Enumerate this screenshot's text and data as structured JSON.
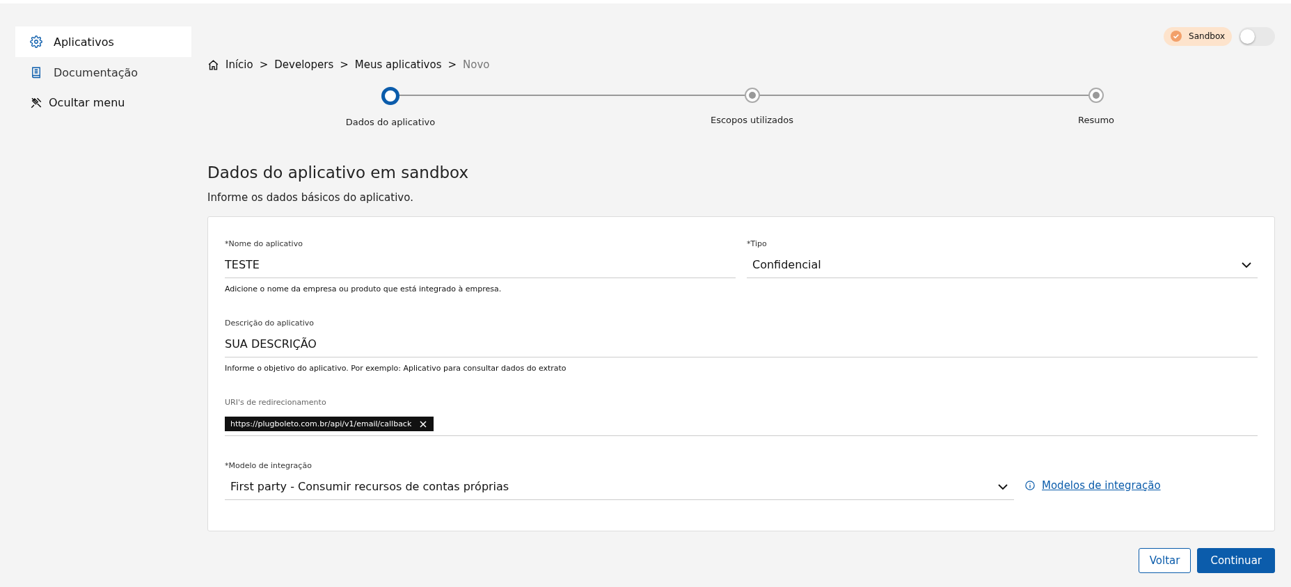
{
  "sidebar": {
    "items": [
      {
        "label": "Aplicativos",
        "kind": "gear",
        "selected": true
      },
      {
        "label": "Documentação",
        "kind": "book",
        "selected": false
      }
    ],
    "hide_menu": "Ocultar menu"
  },
  "sandbox": {
    "label": "Sandbox",
    "on": false
  },
  "breadcrumb": [
    {
      "label": "Início",
      "current": false
    },
    {
      "label": "Developers",
      "current": false
    },
    {
      "label": "Meus aplicativos",
      "current": false
    },
    {
      "label": "Novo",
      "current": true
    }
  ],
  "breadcrumb_separator": ">",
  "stepper": [
    {
      "label": "Dados do aplicativo",
      "current": true
    },
    {
      "label": "Escopos utilizados",
      "current": false
    },
    {
      "label": "Resumo",
      "current": false
    }
  ],
  "title": "Dados do aplicativo em sandbox",
  "subtitle": "Informe os dados básicos do aplicativo.",
  "form": {
    "name": {
      "label": "*Nome do aplicativo",
      "value": "TESTE",
      "hint": "Adicione o nome da empresa ou produto que está integrado à empresa."
    },
    "type": {
      "label": "*Tipo",
      "value": "Confidencial"
    },
    "description": {
      "label": "Descrição do aplicativo",
      "value": "SUA DESCRIÇÃO",
      "hint": "Informe o objetivo do aplicativo. Por exemplo: Aplicativo para consultar dados do extrato"
    },
    "uris": {
      "label": "URI's de redirecionamento",
      "tags": [
        "https://plugboleto.com.br/api/v1/email/callback"
      ]
    },
    "model": {
      "label": "*Modelo de integração",
      "value": "First party - Consumir recursos de contas próprias",
      "link": "Modelos de integração"
    }
  },
  "buttons": {
    "back": "Voltar",
    "next": "Continuar"
  }
}
